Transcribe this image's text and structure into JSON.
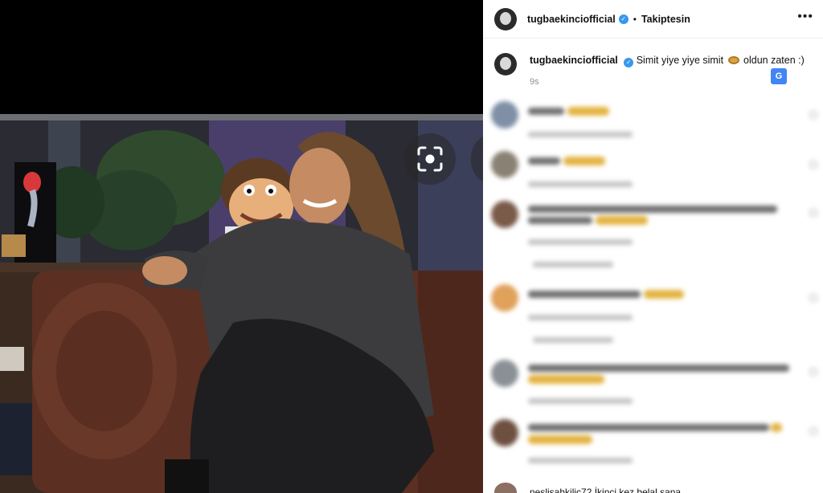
{
  "header": {
    "username": "tugbaekinciofficial",
    "separator": "•",
    "follow_label": "Takiptesin",
    "more_icon": "more-horizontal-icon",
    "more_label": "•••"
  },
  "caption": {
    "username": "tugbaekinciofficial",
    "text": "Simit yiye yiye simit",
    "text_after_emoji": "oldun zaten :)",
    "time": "9s"
  },
  "last_comment": {
    "text": "neslisahkilic72 İkinci kez belal sana"
  },
  "icons": {
    "lens": "visual-search-icon",
    "translate": "translate-icon",
    "verified": "verified-badge-icon",
    "emoji": "simit-emoji-icon"
  },
  "colors": {
    "verified": "#3897f0",
    "panel_bg": "#ffffff",
    "media_bg": "#000000"
  }
}
